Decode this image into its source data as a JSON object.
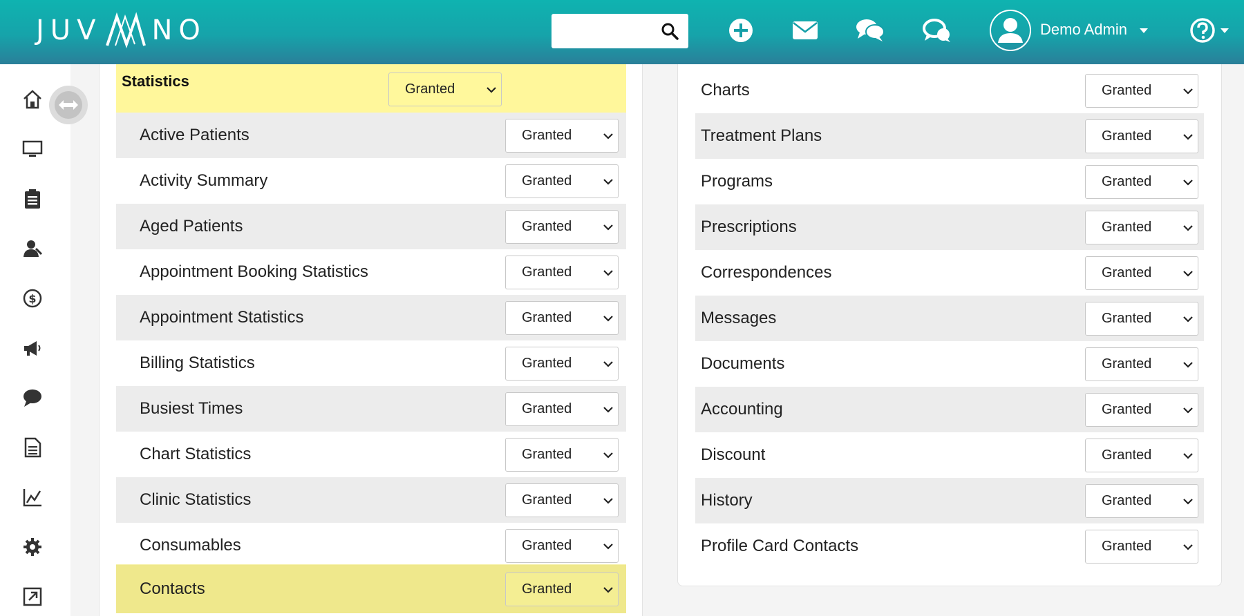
{
  "header": {
    "logo_text_left": "JUV",
    "logo_text_right": "NO",
    "search": {
      "value": "",
      "placeholder": ""
    },
    "icons": [
      "add-icon",
      "mail-icon",
      "chat-icon",
      "support-chat-icon"
    ],
    "user_name": "Demo Admin",
    "help_icon": "help-icon"
  },
  "sidebar": {
    "items": [
      "home-icon",
      "monitor-icon",
      "clipboard-icon",
      "patients-icon",
      "billing-icon",
      "marketing-icon",
      "messages-icon",
      "document-icon",
      "reports-icon",
      "settings-icon",
      "external-link-icon"
    ],
    "collapse_icon": "expand-arrows-icon"
  },
  "left_panel": {
    "section_title": "Statistics",
    "section_value": "Granted",
    "rows": [
      {
        "label": "Active Patients",
        "value": "Granted"
      },
      {
        "label": "Activity Summary",
        "value": "Granted"
      },
      {
        "label": "Aged Patients",
        "value": "Granted"
      },
      {
        "label": "Appointment Booking Statistics",
        "value": "Granted"
      },
      {
        "label": "Appointment Statistics",
        "value": "Granted"
      },
      {
        "label": "Billing Statistics",
        "value": "Granted"
      },
      {
        "label": "Busiest Times",
        "value": "Granted"
      },
      {
        "label": "Chart Statistics",
        "value": "Granted"
      },
      {
        "label": "Clinic Statistics",
        "value": "Granted"
      },
      {
        "label": "Consumables",
        "value": "Granted"
      },
      {
        "label": "Contacts",
        "value": "Granted"
      }
    ]
  },
  "right_panel": {
    "rows": [
      {
        "label": "Charts",
        "value": "Granted"
      },
      {
        "label": "Treatment Plans",
        "value": "Granted"
      },
      {
        "label": "Programs",
        "value": "Granted"
      },
      {
        "label": "Prescriptions",
        "value": "Granted"
      },
      {
        "label": "Correspondences",
        "value": "Granted"
      },
      {
        "label": "Messages",
        "value": "Granted"
      },
      {
        "label": "Documents",
        "value": "Granted"
      },
      {
        "label": "Accounting",
        "value": "Granted"
      },
      {
        "label": "Discount",
        "value": "Granted"
      },
      {
        "label": "History",
        "value": "Granted"
      },
      {
        "label": "Profile Card Contacts",
        "value": "Granted"
      }
    ]
  },
  "colors": {
    "header_top": "#0fb3b0",
    "header_bottom": "#2a7f99",
    "section_yellow": "#fff79b",
    "highlight_yellow": "#efe88c",
    "row_grey": "#ececec",
    "icon_dark": "#3a3a3a"
  }
}
